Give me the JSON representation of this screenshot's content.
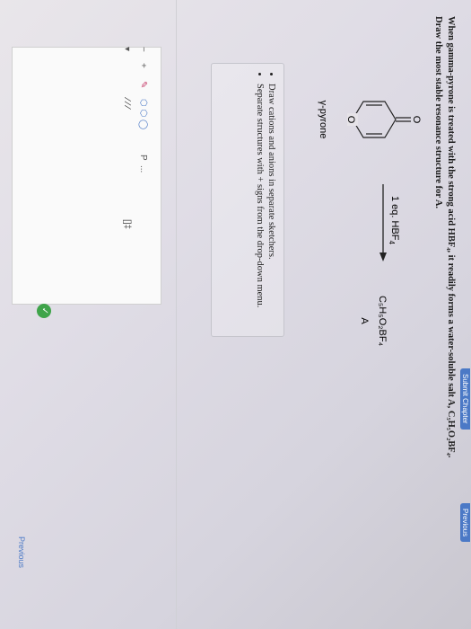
{
  "tabs": {
    "left_tab": "Submit Chapter",
    "right_tab": "Previous"
  },
  "question": {
    "line1": "When gamma-pyrone is treated with the strong acid HBF₄, it readily forms a water-soluble salt A, C₅H₅O₂BF₄.",
    "line2": "Draw the most stable resonance structure for A."
  },
  "scheme": {
    "reactant_oxygen": "O",
    "ring_oxygen": "O",
    "reactant_name": "γ-pyrone",
    "reagent": "1 eq. HBF",
    "reagent_sub": "4",
    "product_formula": "C₅H₅O₂BF₄",
    "product_label": "A"
  },
  "instructions": {
    "items": [
      "Draw cations and anions in separate sketchers.",
      "Separate structures with + signs from the drop-down menu."
    ]
  },
  "toolbar": {
    "charge_minus": "−",
    "charge_plus": "+",
    "pencil": "✎",
    "ring_text": "⬡ ⬡ ◯",
    "dropdown_caret": "▾",
    "element_P": "P",
    "more": "...",
    "bond_text": "∕ ∕ ∕",
    "extra": "[]‡"
  },
  "check_icon": "✓",
  "nav": {
    "previous": "Previous"
  }
}
